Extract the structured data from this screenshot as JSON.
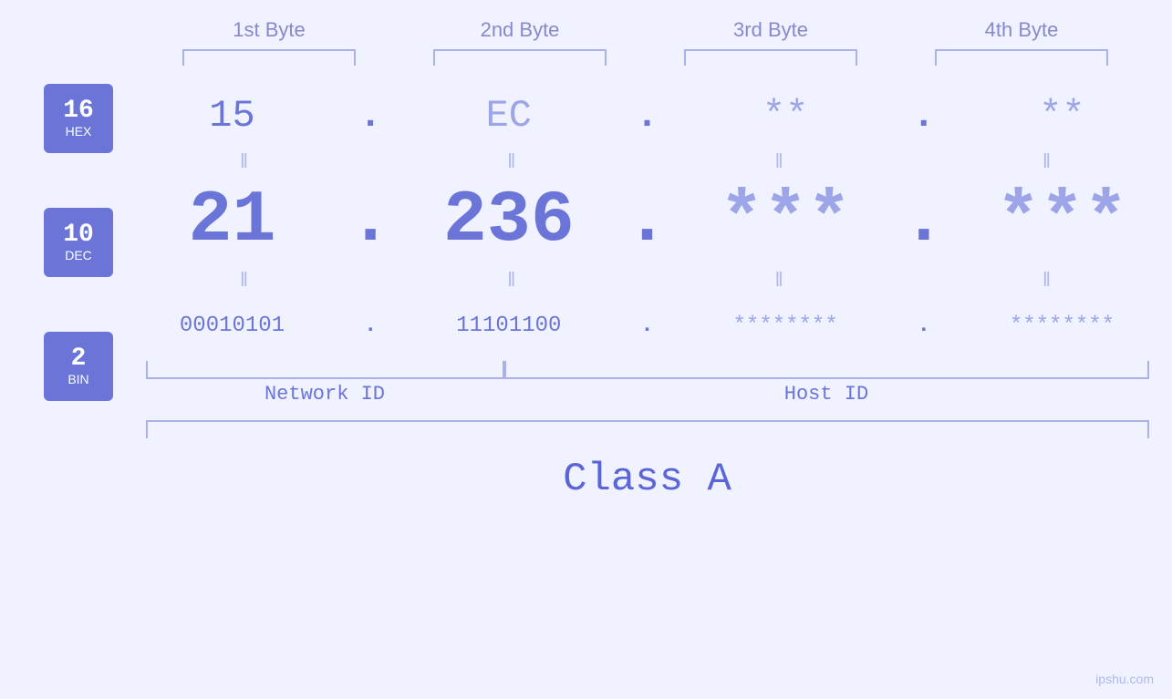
{
  "headers": {
    "byte1": "1st Byte",
    "byte2": "2nd Byte",
    "byte3": "3rd Byte",
    "byte4": "4th Byte"
  },
  "badges": {
    "hex": {
      "num": "16",
      "base": "HEX"
    },
    "dec": {
      "num": "10",
      "base": "DEC"
    },
    "bin": {
      "num": "2",
      "base": "BIN"
    }
  },
  "hex_row": {
    "b1": "15",
    "b2": "EC",
    "b3": "**",
    "b4": "**",
    "d1": ".",
    "d2": ".",
    "d3": ".",
    "d4": "."
  },
  "dec_row": {
    "b1": "21",
    "b2": "236",
    "b3": "***",
    "b4": "***",
    "d1": ".",
    "d2": ".",
    "d3": ".",
    "d4": "."
  },
  "bin_row": {
    "b1": "00010101",
    "b2": "11101100",
    "b3": "********",
    "b4": "********",
    "d1": ".",
    "d2": ".",
    "d3": ".",
    "d4": "."
  },
  "labels": {
    "network_id": "Network ID",
    "host_id": "Host ID",
    "class": "Class A"
  },
  "watermark": "ipshu.com"
}
